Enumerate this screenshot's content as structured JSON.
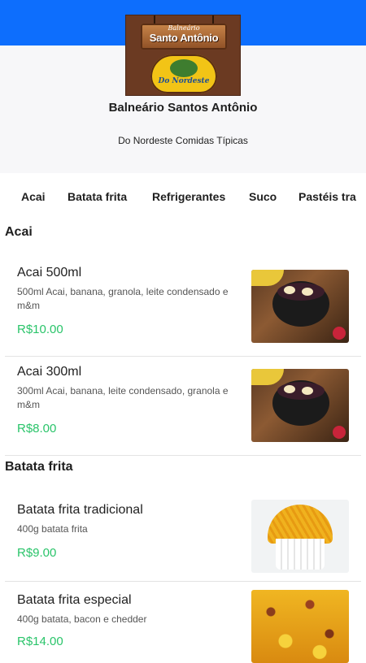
{
  "store": {
    "logo_text_top": "Balneário",
    "logo_text_main": "Santo Antônio",
    "logo_text_bottom": "Do Nordeste",
    "name": "Balneário Santos Antônio",
    "subtitle": "Do Nordeste Comidas Típicas"
  },
  "tabs": [
    "Acai",
    "Batata frita",
    "Refrigerantes",
    "Suco",
    "Pastéis tra"
  ],
  "sections": [
    {
      "title": "Acai",
      "items": [
        {
          "name": "Acai 500ml",
          "description": "500ml Acai, banana, granola, leite condensado e m&m",
          "price": "R$10.00",
          "image": "acai-bowl-image"
        },
        {
          "name": "Acai 300ml",
          "description": "300ml Acai, banana, leite condensado, granola e m&m",
          "price": "R$8.00",
          "image": "acai-bowl-image"
        }
      ]
    },
    {
      "title": "Batata frita",
      "items": [
        {
          "name": "Batata frita tradicional",
          "description": "400g batata frita",
          "price": "R$9.00",
          "image": "fries-image"
        },
        {
          "name": "Batata frita especial",
          "description": "400g batata, bacon e chedder",
          "price": "R$14.00",
          "image": "fries-special-image"
        }
      ]
    }
  ],
  "colors": {
    "topbar": "#0d6efd",
    "price": "#2ac46a",
    "hero_bg": "#f7f7f9"
  }
}
